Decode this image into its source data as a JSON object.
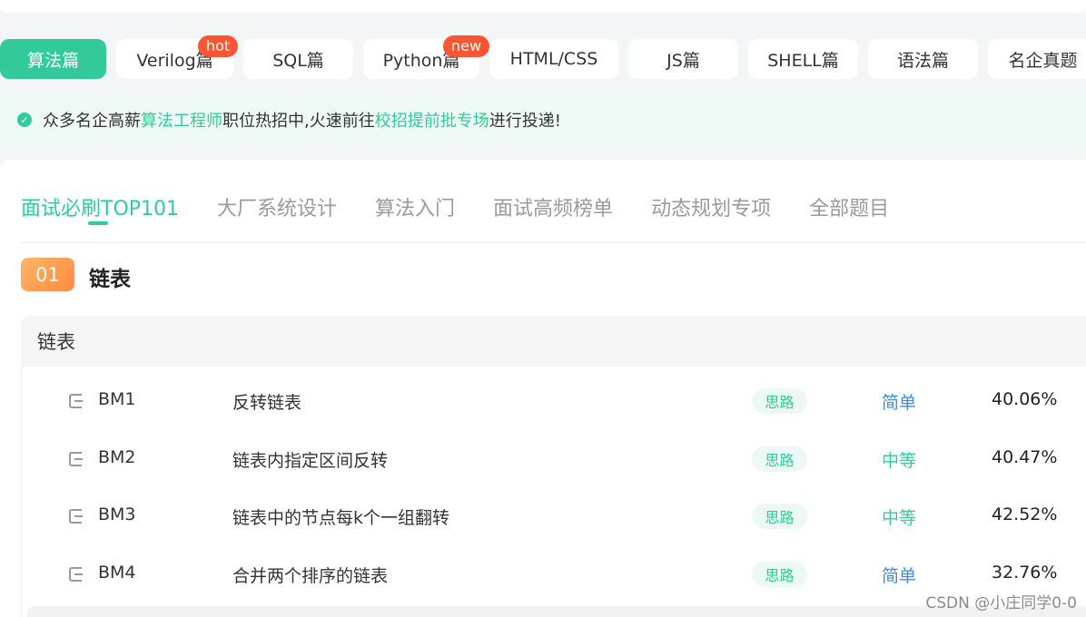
{
  "categories": [
    {
      "label": "算法篇",
      "active": true
    },
    {
      "label": "Verilog篇",
      "badge": "hot"
    },
    {
      "label": "SQL篇"
    },
    {
      "label": "Python篇",
      "badge": "new"
    },
    {
      "label": "HTML/CSS"
    },
    {
      "label": "JS篇"
    },
    {
      "label": "SHELL篇"
    },
    {
      "label": "语法篇"
    },
    {
      "label": "名企真题"
    }
  ],
  "notice": {
    "prefix": "众多名企高薪",
    "link1": "算法工程师",
    "middle": "职位热招中,火速前往",
    "link2": "校招提前批专场",
    "suffix": "进行投递!"
  },
  "tabs": [
    "面试必刷TOP101",
    "大厂系统设计",
    "算法入门",
    "面试高频榜单",
    "动态规划专项",
    "全部题目"
  ],
  "section": {
    "number": "01",
    "title": "链表"
  },
  "list_header": "链表",
  "rows": [
    {
      "id": "BM1",
      "title": "反转链表",
      "tag": "思路",
      "difficulty": "简单",
      "rate": "40.06%"
    },
    {
      "id": "BM2",
      "title": "链表内指定区间反转",
      "tag": "思路",
      "difficulty": "中等",
      "rate": "40.47%"
    },
    {
      "id": "BM3",
      "title": "链表中的节点每k个一组翻转",
      "tag": "思路",
      "difficulty": "中等",
      "rate": "42.52%"
    },
    {
      "id": "BM4",
      "title": "合并两个排序的链表",
      "tag": "思路",
      "difficulty": "简单",
      "rate": "32.76%"
    }
  ],
  "colors": {
    "accent": "#32ca99",
    "easy": "#3f8be0",
    "medium": "#32ca99",
    "badge": "#fc5531"
  },
  "watermark": "CSDN @小庄同学0-0"
}
